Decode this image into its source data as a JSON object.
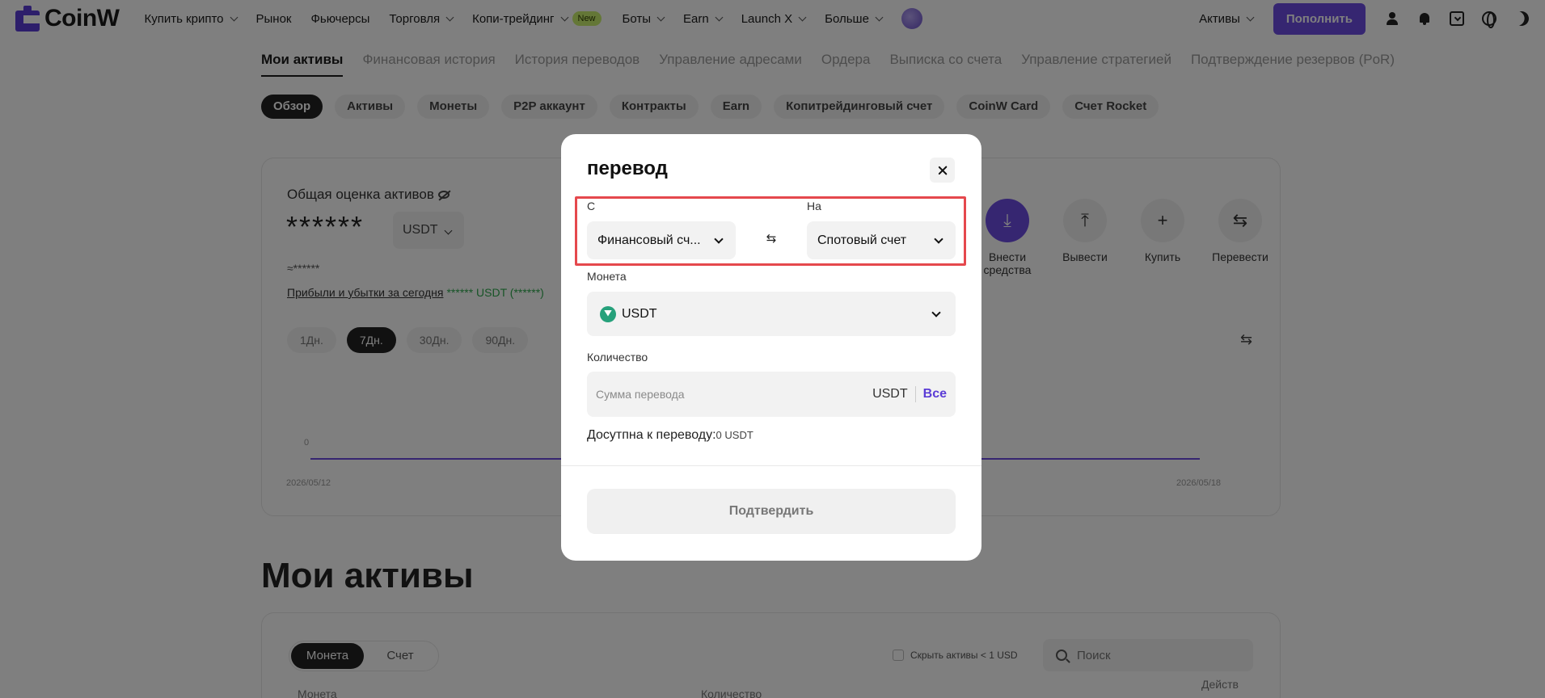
{
  "header": {
    "logo_text": "CoinW",
    "menu": [
      {
        "label": "Купить крипто"
      },
      {
        "label": "Рынок"
      },
      {
        "label": "Фьючерсы"
      },
      {
        "label": "Торговля"
      },
      {
        "label": "Копи-трейдинг",
        "badge": "New"
      },
      {
        "label": "Боты"
      },
      {
        "label": "Earn"
      },
      {
        "label": "Launch X"
      },
      {
        "label": "Больше"
      }
    ],
    "assets_label": "Активы",
    "deposit_label": "Пополнить"
  },
  "subtabs": [
    "Мои активы",
    "Финансовая история",
    "История переводов",
    "Управление адресами",
    "Ордера",
    "Выписка со счета",
    "Управление стратегией",
    "Подтверждение резервов (PoR)"
  ],
  "pills": [
    "Обзор",
    "Активы",
    "Монеты",
    "P2P аккаунт",
    "Контракты",
    "Earn",
    "Копитрейдинговый счет",
    "CoinW Card",
    "Счет Rocket"
  ],
  "overview": {
    "title": "Общая оценка активов",
    "amount": "******",
    "currency": "USDT",
    "approx": "≈******",
    "pnl_label": "Прибыли и убытки за сегодня",
    "pnl_value": "****** USDT (******)",
    "periods": [
      "1Дн.",
      "7Дн.",
      "30Дн.",
      "90Дн."
    ],
    "chart_zero": "0",
    "date_start": "2026/05/12",
    "date_end": "2026/05/18",
    "actions": [
      "Внести средства",
      "Вывести",
      "Купить",
      "Перевести"
    ]
  },
  "my_assets": {
    "heading": "Мои активы",
    "seg": [
      "Монета",
      "Счет"
    ],
    "hide_small": "Скрыть активы < 1 USD",
    "search_placeholder": "Поиск",
    "col_coin": "Монета",
    "col_qty": "Количество",
    "col_actions": "Действ"
  },
  "modal": {
    "title": "перевод",
    "from_label": "С",
    "from_value": "Финансовый сч...",
    "to_label": "На",
    "to_value": "Спотовый счет",
    "coin_label": "Монета",
    "coin_value": "USDT",
    "qty_label": "Количество",
    "qty_placeholder": "Сумма перевода",
    "qty_unit": "USDT",
    "qty_all": "Все",
    "available_label": "Досутпна к переводу:",
    "available_value": "0 USDT",
    "confirm_label": "Подтвердить"
  },
  "colors": {
    "accent": "#6c4ce3",
    "highlight": "#e5484d",
    "usdt": "#26a17b"
  }
}
